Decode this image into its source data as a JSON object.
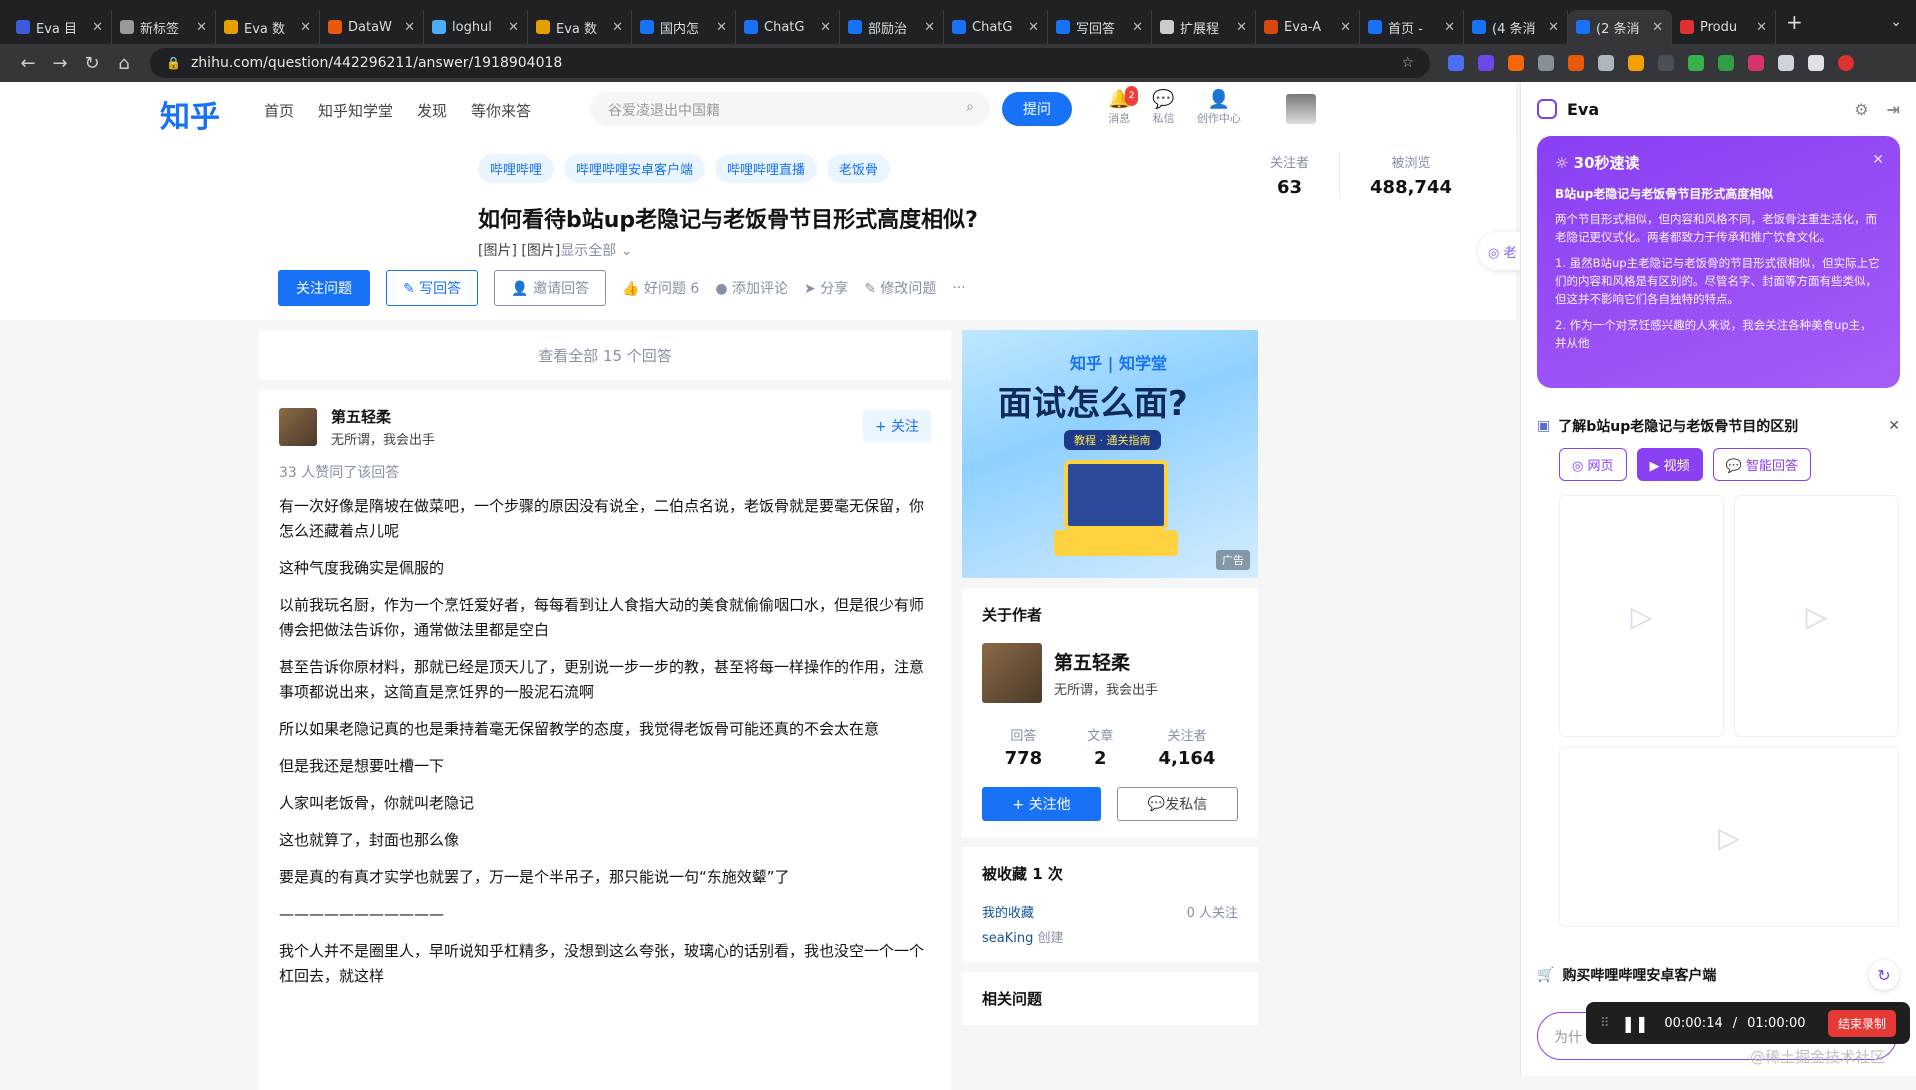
{
  "browser": {
    "tabs": [
      {
        "title": "Eva 目",
        "color": "#3b5bdb",
        "active": false
      },
      {
        "title": "新标签",
        "color": "#999999",
        "active": false
      },
      {
        "title": "Eva 数",
        "color": "#e5a000",
        "active": false
      },
      {
        "title": "DataW",
        "color": "#e8590c",
        "active": false
      },
      {
        "title": "loghul",
        "color": "#4dabf7",
        "active": false
      },
      {
        "title": "Eva 数",
        "color": "#e5a000",
        "active": false
      },
      {
        "title": "国内怎",
        "color": "#1772f6",
        "active": false
      },
      {
        "title": "ChatG",
        "color": "#1772f6",
        "active": false
      },
      {
        "title": "部励治",
        "color": "#1772f6",
        "active": false
      },
      {
        "title": "ChatG",
        "color": "#1772f6",
        "active": false
      },
      {
        "title": "写回答",
        "color": "#1772f6",
        "active": false
      },
      {
        "title": "扩展程",
        "color": "#cccccc",
        "active": false
      },
      {
        "title": "Eva-A",
        "color": "#d9480f",
        "active": false
      },
      {
        "title": "首页 -",
        "color": "#1772f6",
        "active": false
      },
      {
        "title": "(4 条消",
        "color": "#1772f6",
        "active": false
      },
      {
        "title": "(2 条消",
        "color": "#1772f6",
        "active": true
      },
      {
        "title": "Produ",
        "color": "#e03131",
        "active": false
      }
    ],
    "new_tab": "+",
    "url": "zhihu.com/question/442296211/answer/1918904018"
  },
  "header": {
    "logo": "知乎",
    "nav": [
      "首页",
      "知乎知学堂",
      "发现",
      "等你来答"
    ],
    "search_placeholder": "谷爱凌退出中国籍",
    "ask_label": "提问",
    "icons": [
      {
        "name": "messages",
        "label": "消息",
        "badge": "2"
      },
      {
        "name": "private-msg",
        "label": "私信"
      },
      {
        "name": "creator-center",
        "label": "创作中心"
      }
    ]
  },
  "question": {
    "topics": [
      "哔哩哔哩",
      "哔哩哔哩安卓客户端",
      "哔哩哔哩直播",
      "老饭骨"
    ],
    "title": "如何看待b站up老隐记与老饭骨节目形式高度相似?",
    "desc": "[图片] [图片]",
    "desc_more": "显示全部 ⌄",
    "followers_label": "关注者",
    "followers": "63",
    "views_label": "被浏览",
    "views": "488,744",
    "actions": {
      "follow": "关注问题",
      "write": "✎ 写回答",
      "invite": "邀请回答",
      "good": "好问题 6",
      "comment": "添加评论",
      "share": "分享",
      "edit": "修改问题",
      "more": "···"
    }
  },
  "view_all": "查看全部 15 个回答",
  "answer": {
    "author": "第五轻柔",
    "bio": "无所谓，我会出手",
    "follow": "+ 关注",
    "votes": "33 人赞同了该回答",
    "paragraphs": [
      "有一次好像是隋坡在做菜吧，一个步骤的原因没有说全，二伯点名说，老饭骨就是要毫无保留，你怎么还藏着点儿呢",
      "这种气度我确实是佩服的",
      "以前我玩名厨，作为一个烹饪爱好者，每每看到让人食指大动的美食就偷偷咽口水，但是很少有师傅会把做法告诉你，通常做法里都是空白",
      "甚至告诉你原材料，那就已经是顶天儿了，更别说一步一步的教，甚至将每一样操作的作用，注意事项都说出来，这简直是烹饪界的一股泥石流啊",
      "所以如果老隐记真的也是秉持着毫无保留教学的态度，我觉得老饭骨可能还真的不会太在意",
      "但是我还是想要吐槽一下",
      "人家叫老饭骨，你就叫老隐记",
      "这也就算了，封面也那么像",
      "要是真的有真才实学也就罢了，万一是个半吊子，那只能说一句“东施效颦”了",
      "———————————",
      "我个人并不是圈里人，早听说知乎杠精多，没想到这么夸张，玻璃心的话别看，我也没空一个一个杠回去，就这样"
    ]
  },
  "ad": {
    "brand": "知乎 | 知学堂",
    "headline": "面试怎么面?",
    "pill": "教程 · 通关指南",
    "tag": "广告"
  },
  "about": {
    "heading": "关于作者",
    "name": "第五轻柔",
    "bio": "无所谓，我会出手",
    "stats": [
      {
        "label": "回答",
        "value": "778"
      },
      {
        "label": "文章",
        "value": "2"
      },
      {
        "label": "关注者",
        "value": "4,164"
      }
    ],
    "follow": "+ 关注他",
    "message": "发私信"
  },
  "collected": {
    "heading": "被收藏 1 次",
    "folder": "我的收藏",
    "followers": "0 人关注",
    "creator": "seaKing",
    "creator_suffix": "创建"
  },
  "related": {
    "heading": "相关问题"
  },
  "float_pill": "老",
  "eva": {
    "title": "Eva",
    "speed": {
      "title": "30秒速读",
      "subtitle": "B站up老隐记与老饭骨节目形式高度相似",
      "p1": "两个节目形式相似，但内容和风格不同，老饭骨注重生活化，而老隐记更仪式化。两者都致力于传承和推广饮食文化。",
      "p2": "1. 虽然B站up主老隐记与老饭骨的节目形式很相似，但实际上它们的内容和风格是有区别的。尽管名字、封面等方面有些类似，但这并不影响它们各自独特的特点。",
      "p3": "2. 作为一个对烹饪感兴趣的人来说，我会关注各种美食up主，并从他"
    },
    "learn": {
      "title": "了解b站up老隐记与老饭骨节目的区别",
      "chips": [
        "网页",
        "视频",
        "智能回答"
      ],
      "active_chip": 1
    },
    "buy": "购买哔哩哔哩安卓客户端",
    "input_placeholder": "为什"
  },
  "recorder": {
    "elapsed": "00:00:14",
    "separator": "/",
    "total": "01:00:00",
    "end": "结束录制"
  },
  "watermark": "@稀土掘金技术社区"
}
